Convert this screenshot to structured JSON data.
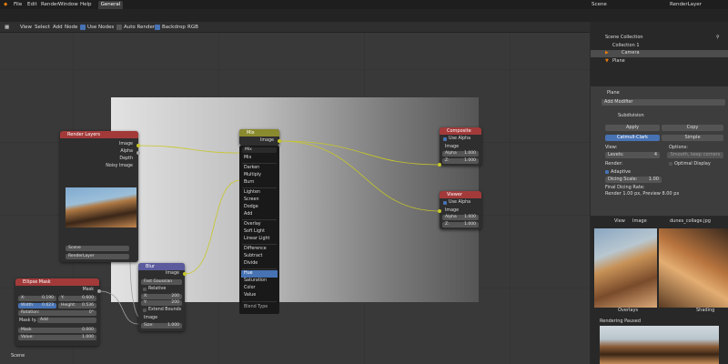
{
  "menu": {
    "items": [
      "File",
      "Edit",
      "Render",
      "Window",
      "Help"
    ],
    "active_tab": "General",
    "scene": "Scene",
    "view_layer": "RenderLayer"
  },
  "editor_header": {
    "items": [
      "View",
      "Select",
      "Add",
      "Node"
    ],
    "use_nodes": "Use Nodes",
    "auto_render": "Auto Render",
    "backdrop": "Backdrop",
    "channel_buttons": "RGB"
  },
  "outliner": {
    "root": "Scene Collection",
    "collection": "Collection 1",
    "items": [
      "Camera",
      "Plane"
    ]
  },
  "properties": {
    "object": "Plane",
    "add_modifier": "Add Modifier",
    "modifier": "Subdivision",
    "apply": "Apply",
    "copy": "Copy",
    "catmull": "Catmull-Clark",
    "simple": "Simple",
    "view_label": "View:",
    "levels_label": "Levels:",
    "levels_value": "4",
    "render_label": "Render:",
    "options_label": "Options:",
    "smooth": "Smooth, keep corners",
    "optimal": "Optimal Display",
    "adaptive": "Adaptive",
    "dicing_label": "Dicing Scale:",
    "dicing_value": "1.00",
    "final_rate": "Final Dicing Rate:",
    "final_rate_value": "Render 1.00 px, Preview 8.00 px"
  },
  "image_editor": {
    "view": "View",
    "image": "Image",
    "filename": "dunes_collage.jpg",
    "overlays": "Overlays",
    "shading": "Shading",
    "status": "Rendering Paused"
  },
  "nodes": {
    "render_layers": {
      "title": "Render Layers",
      "outputs": [
        "Image",
        "Alpha",
        "Depth",
        "Noisy Image"
      ],
      "scene": "Scene",
      "layer": "RenderLayer"
    },
    "mix": {
      "title": "Mix",
      "output": "Image",
      "mode": "Mix"
    },
    "composite": {
      "title": "Composite",
      "use_alpha": "Use Alpha",
      "image": "Image",
      "alpha": "Alpha",
      "alpha_v": "1.000",
      "z": "Z:",
      "z_v": "1.000"
    },
    "viewer": {
      "title": "Viewer",
      "use_alpha": "Use Alpha",
      "image": "Image",
      "alpha": "Alpha",
      "alpha_v": "1.000",
      "z": "Z:",
      "z_v": "1.000"
    },
    "blur": {
      "title": "Blur",
      "output": "Image",
      "type": "Fast Gaussian",
      "relative": "Relative",
      "x": "X:",
      "x_v": "200",
      "y": "Y:",
      "y_v": "200",
      "extend": "Extend Bounds",
      "image": "Image",
      "size": "Size:",
      "size_v": "1.000"
    },
    "ellipse": {
      "title": "Ellipse Mask",
      "mask_out": "Mask",
      "x": "X:",
      "x_v": "0.190",
      "y": "Y:",
      "y_v": "0.600",
      "width": "Width:",
      "width_v": "0.623",
      "height": "Height:",
      "height_v": "0.536",
      "rotation": "Rotation:",
      "rotation_v": "0°",
      "mask_type": "Mask ty...",
      "mask_type_v": "Add",
      "mask": "Mask",
      "mask_v": "0.000",
      "value": "Value:",
      "value_v": "1.000"
    }
  },
  "blend_menu": {
    "search": "Mix",
    "items": [
      "Mix",
      "Darken",
      "Multiply",
      "Burn",
      "Lighten",
      "Screen",
      "Dodge",
      "Add",
      "Overlay",
      "Soft Light",
      "Linear Light",
      "Difference",
      "Subtract",
      "Divide",
      "Hue",
      "Saturation",
      "Color",
      "Value"
    ],
    "highlighted": "Hue",
    "footer": "Blend Type"
  },
  "footer": {
    "scene_label": "Scene"
  }
}
